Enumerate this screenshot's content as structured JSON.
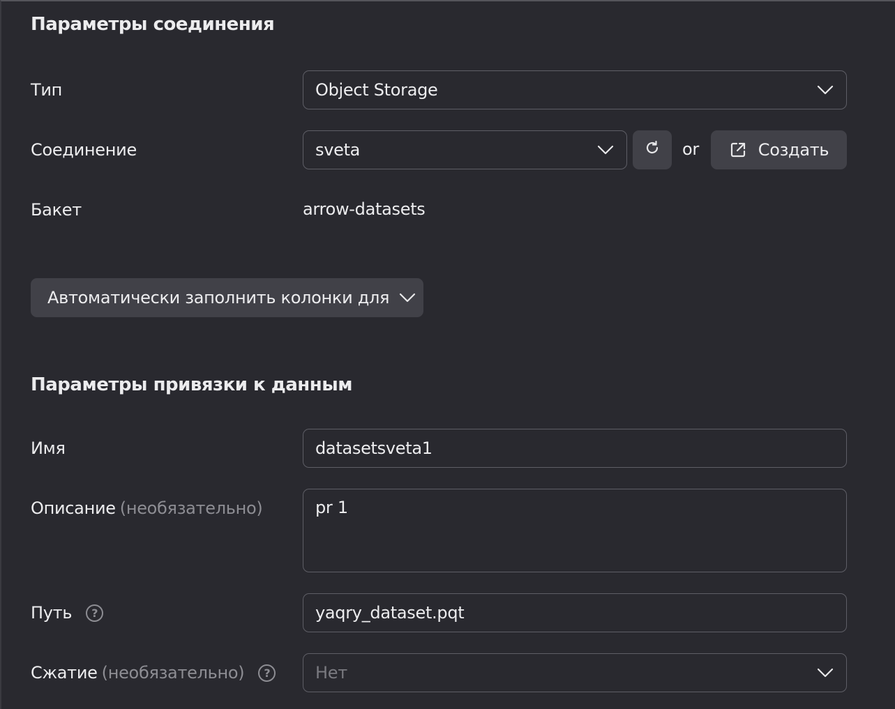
{
  "connection_section": {
    "title": "Параметры соединения",
    "type": {
      "label": "Тип",
      "value": "Object Storage"
    },
    "connection": {
      "label": "Соединение",
      "value": "sveta",
      "or_text": "or",
      "create_label": "Создать"
    },
    "bucket": {
      "label": "Бакет",
      "value": "arrow-datasets"
    },
    "autofill_label": "Автоматически заполнить колонки для"
  },
  "binding_section": {
    "title": "Параметры привязки к данным",
    "name": {
      "label": "Имя",
      "value": "datasetsveta1"
    },
    "description": {
      "label": "Описание",
      "optional": "(необязательно)",
      "value": "pr 1"
    },
    "path": {
      "label": "Путь",
      "help": "?",
      "value": "yaqry_dataset.pqt"
    },
    "compression": {
      "label": "Сжатие",
      "optional": "(необязательно)",
      "help": "?",
      "placeholder": "Нет"
    }
  },
  "icons": {
    "dropdown": "chevron-down-icon",
    "refresh": "refresh-icon",
    "external": "external-link-icon",
    "help": "help-icon"
  },
  "colors": {
    "background": "#29292f",
    "field_border": "#5e5e66",
    "button_bg": "#414148",
    "muted_text": "#8d8d93"
  }
}
